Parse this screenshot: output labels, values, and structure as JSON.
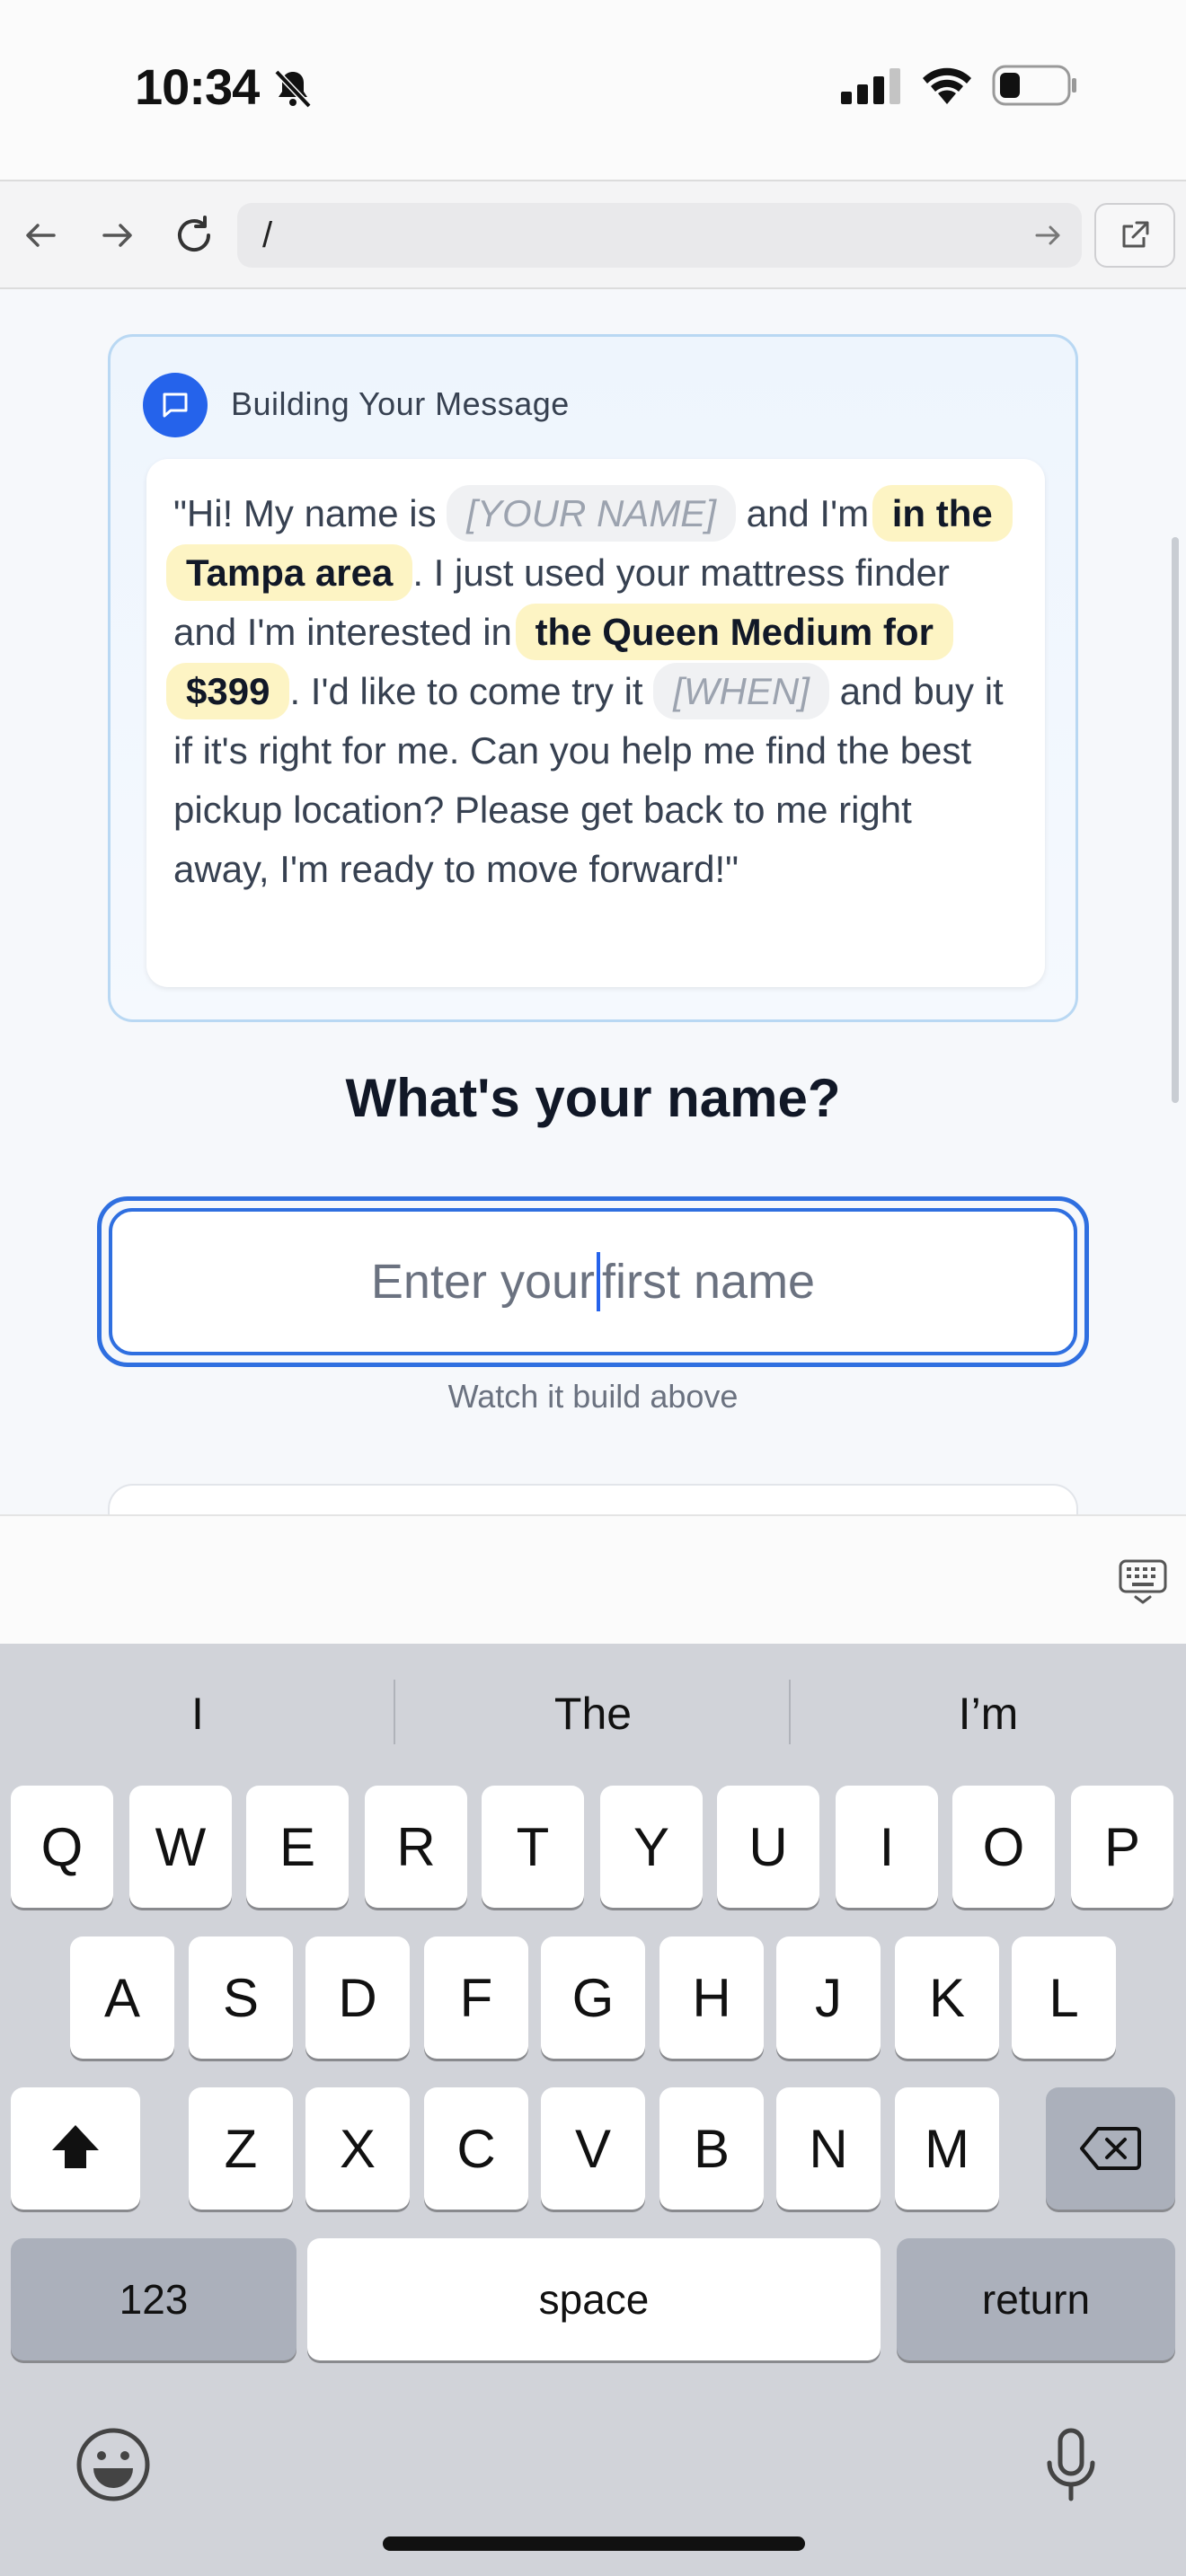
{
  "status_bar": {
    "time": "10:34"
  },
  "browser": {
    "url": "/"
  },
  "message_card": {
    "title": "Building Your Message",
    "parts": {
      "p1": "\"Hi! My name is ",
      "name_placeholder": "[YOUR NAME]",
      "p2": " and I'm ",
      "location": "in the Tampa area",
      "p3": ". I just used your mattress finder and I'm interested in ",
      "product": "the Queen Medium for $399",
      "p4": ". I'd like to come try it ",
      "when_placeholder": "[WHEN]",
      "p5": " and buy it if it's right for me. Can you help me find the best pickup location? Please get back to me right away, I'm ready to move forward!\""
    }
  },
  "question": "What's your name?",
  "name_input": {
    "placeholder_before_caret": "Enter your",
    "placeholder_after_caret": "first name"
  },
  "hint": "Watch it build above",
  "keyboard": {
    "suggestions": [
      "I",
      "The",
      "I’m"
    ],
    "row1": [
      "Q",
      "W",
      "E",
      "R",
      "T",
      "Y",
      "U",
      "I",
      "O",
      "P"
    ],
    "row2": [
      "A",
      "S",
      "D",
      "F",
      "G",
      "H",
      "J",
      "K",
      "L"
    ],
    "row3": [
      "Z",
      "X",
      "C",
      "V",
      "B",
      "N",
      "M"
    ],
    "numbers_label": "123",
    "space_label": "space",
    "return_label": "return"
  }
}
